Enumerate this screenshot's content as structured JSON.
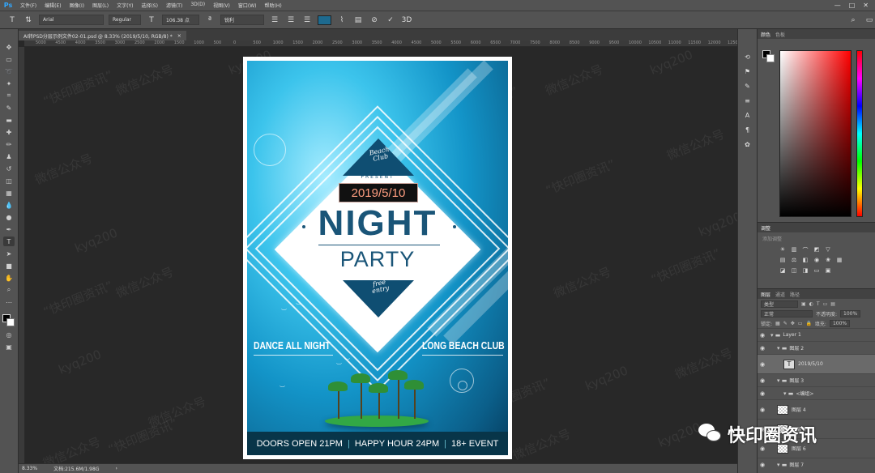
{
  "app": {
    "logo": "Ps"
  },
  "menu": [
    "文件(F)",
    "编辑(E)",
    "图像(I)",
    "图层(L)",
    "文字(Y)",
    "选择(S)",
    "滤镜(T)",
    "3D(D)",
    "视图(V)",
    "窗口(W)",
    "帮助(H)"
  ],
  "window_controls": [
    "—",
    "□",
    "✕"
  ],
  "options": {
    "font_family": "Arial",
    "font_style": "Regular",
    "font_size": "106.38 点",
    "antialias": "锐利",
    "text_color": "#1d6a8f"
  },
  "document_tab": {
    "title": "AI转PSD分层示例文件02-01.psd @ 8.33% (2019/5/10, RGB/8) *",
    "close": "×"
  },
  "ruler_ticks": [
    "5000",
    "4500",
    "4000",
    "3500",
    "3000",
    "2500",
    "2000",
    "1500",
    "1000",
    "500",
    "0",
    "500",
    "1000",
    "1500",
    "2000",
    "2500",
    "3000",
    "3500",
    "4000",
    "4500",
    "5000",
    "5500",
    "6000",
    "6500",
    "7000",
    "7500",
    "8000",
    "8500",
    "9000",
    "9500",
    "10000",
    "10500",
    "11000",
    "11500",
    "12000",
    "12500"
  ],
  "watermarks": [
    "“快印圈资讯”",
    "微信公众号",
    "kyq200"
  ],
  "poster": {
    "beach_club": "Beach Club",
    "present": "PRESENT",
    "date": "2019/5/10",
    "night": "NIGHT",
    "party": "PARTY",
    "free_entry": "free entry",
    "left_text": "DANCE ALL NIGHT",
    "right_text": "LONG BEACH CLUB",
    "bottom": [
      "DOORS OPEN 21PM",
      "HAPPY HOUR 24PM",
      "18+ EVENT"
    ],
    "separator": "|"
  },
  "status": {
    "zoom": "8.33%",
    "doc": "文档:215.6M/1.98G",
    "arrow": "›"
  },
  "panels": {
    "color_tabs": [
      "颜色",
      "色板"
    ],
    "adjust_tab": "调整",
    "adjust_hint": "添加调整",
    "layers_tabs": [
      "图层",
      "通道",
      "路径"
    ],
    "filter_kind": "类型",
    "blend_mode": "正常",
    "opacity_label": "不透明度:",
    "opacity_value": "100%",
    "lock_label": "锁定:",
    "fill_label": "填充:",
    "fill_value": "100%"
  },
  "layers": [
    {
      "name": "Layer 1",
      "type": "group",
      "indent": 0
    },
    {
      "name": "图层 2",
      "type": "group",
      "indent": 1
    },
    {
      "name": "2019/5/10",
      "type": "text",
      "indent": 2,
      "active": true
    },
    {
      "name": "图层 3",
      "type": "group",
      "indent": 1
    },
    {
      "name": "<编组>",
      "type": "group",
      "indent": 2
    },
    {
      "name": "图层 4",
      "type": "pixel",
      "indent": 1
    },
    {
      "name": "图层 5",
      "type": "pixel",
      "indent": 1
    },
    {
      "name": "图层 6",
      "type": "pixel",
      "indent": 1
    },
    {
      "name": "图层 7",
      "type": "group",
      "indent": 1
    }
  ],
  "wechat": {
    "label": "快印圈资讯"
  },
  "colors": {
    "accent": "#31a8ff",
    "poster_dark": "#0f4e72",
    "date_text": "#ff9e80"
  }
}
